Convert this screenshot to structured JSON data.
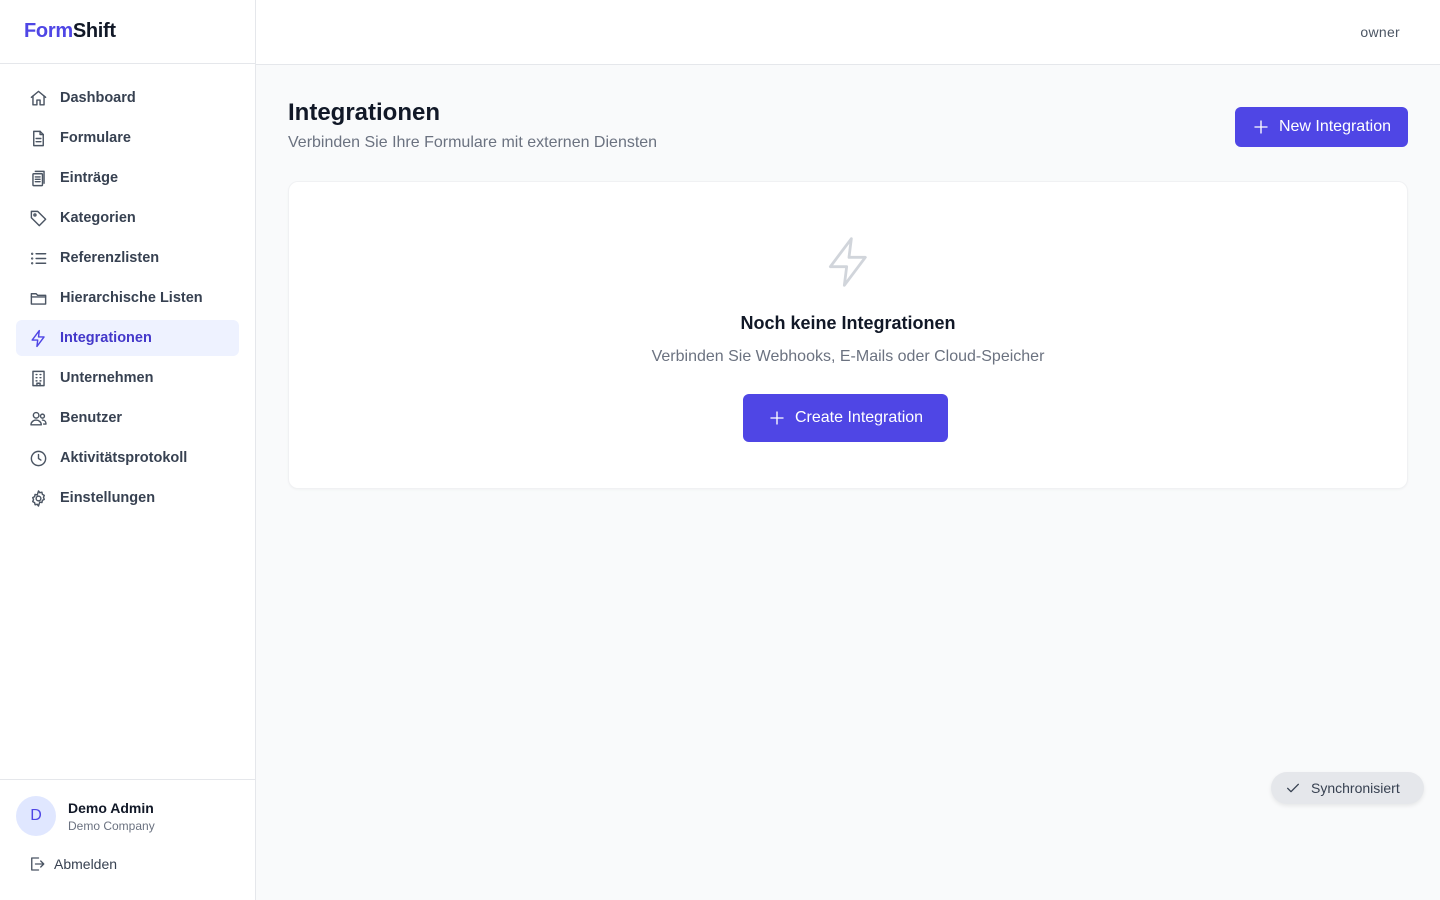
{
  "brand": {
    "part1": "Form",
    "part2": "Shift"
  },
  "sidebar": {
    "items": [
      {
        "label": "Dashboard",
        "icon": "home-icon"
      },
      {
        "label": "Formulare",
        "icon": "document-icon"
      },
      {
        "label": "Einträge",
        "icon": "entries-icon"
      },
      {
        "label": "Kategorien",
        "icon": "tag-icon"
      },
      {
        "label": "Referenzlisten",
        "icon": "list-icon"
      },
      {
        "label": "Hierarchische Listen",
        "icon": "folder-icon"
      },
      {
        "label": "Integrationen",
        "icon": "lightning-icon",
        "active": true
      },
      {
        "label": "Unternehmen",
        "icon": "building-icon"
      },
      {
        "label": "Benutzer",
        "icon": "users-icon"
      },
      {
        "label": "Aktivitätsprotokoll",
        "icon": "clock-icon"
      },
      {
        "label": "Einstellungen",
        "icon": "gear-icon"
      }
    ]
  },
  "user": {
    "initial": "D",
    "name": "Demo Admin",
    "company": "Demo Company",
    "logout_label": "Abmelden"
  },
  "header": {
    "role": "owner"
  },
  "page": {
    "title": "Integrationen",
    "subtitle": "Verbinden Sie Ihre Formulare mit externen Diensten",
    "new_button_label": "New Integration"
  },
  "empty_state": {
    "icon": "lightning-icon",
    "title": "Noch keine Integrationen",
    "text": "Verbinden Sie Webhooks, E-Mails oder Cloud-Speicher",
    "button_label": "Create Integration"
  },
  "toast": {
    "icon": "check-icon",
    "label": "Synchronisiert"
  },
  "colors": {
    "accent": "#4f46e5",
    "active_bg": "#eef2ff",
    "background": "#f9fafb"
  }
}
